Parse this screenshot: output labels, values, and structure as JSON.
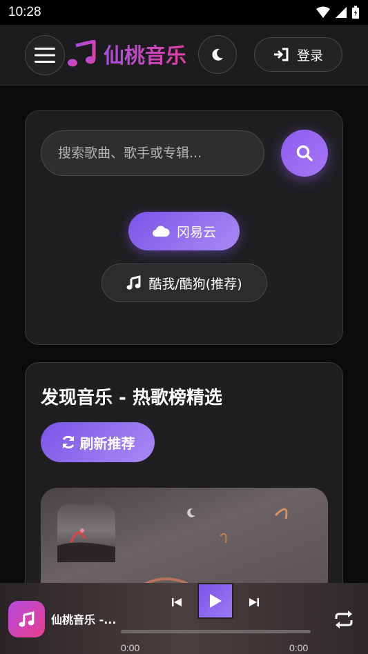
{
  "status_bar": {
    "time": "10:28"
  },
  "header": {
    "app_name": "仙桃音乐",
    "login_label": "登录",
    "icons": {
      "menu": "hamburger-icon",
      "logo": "music-note-icon",
      "theme": "moon-icon",
      "login": "sign-in-icon"
    }
  },
  "search": {
    "placeholder": "搜索歌曲、歌手或专辑...",
    "value": "",
    "sources": [
      {
        "label": "冈易云",
        "icon": "cloud-icon",
        "active": true
      },
      {
        "label": "酷我/酷狗(推荐)",
        "icon": "music-note-icon",
        "active": false
      }
    ]
  },
  "discover": {
    "title": "发现音乐 - 热歌榜精选",
    "refresh_label": "刷新推荐"
  },
  "player": {
    "title": "仙桃音乐 -...",
    "current_time": "0:00",
    "duration": "0:00",
    "progress": 0
  },
  "colors": {
    "accent": "#8c5cf0",
    "brand_gradient_start": "#a94fe0",
    "brand_gradient_end": "#e23f9f"
  }
}
